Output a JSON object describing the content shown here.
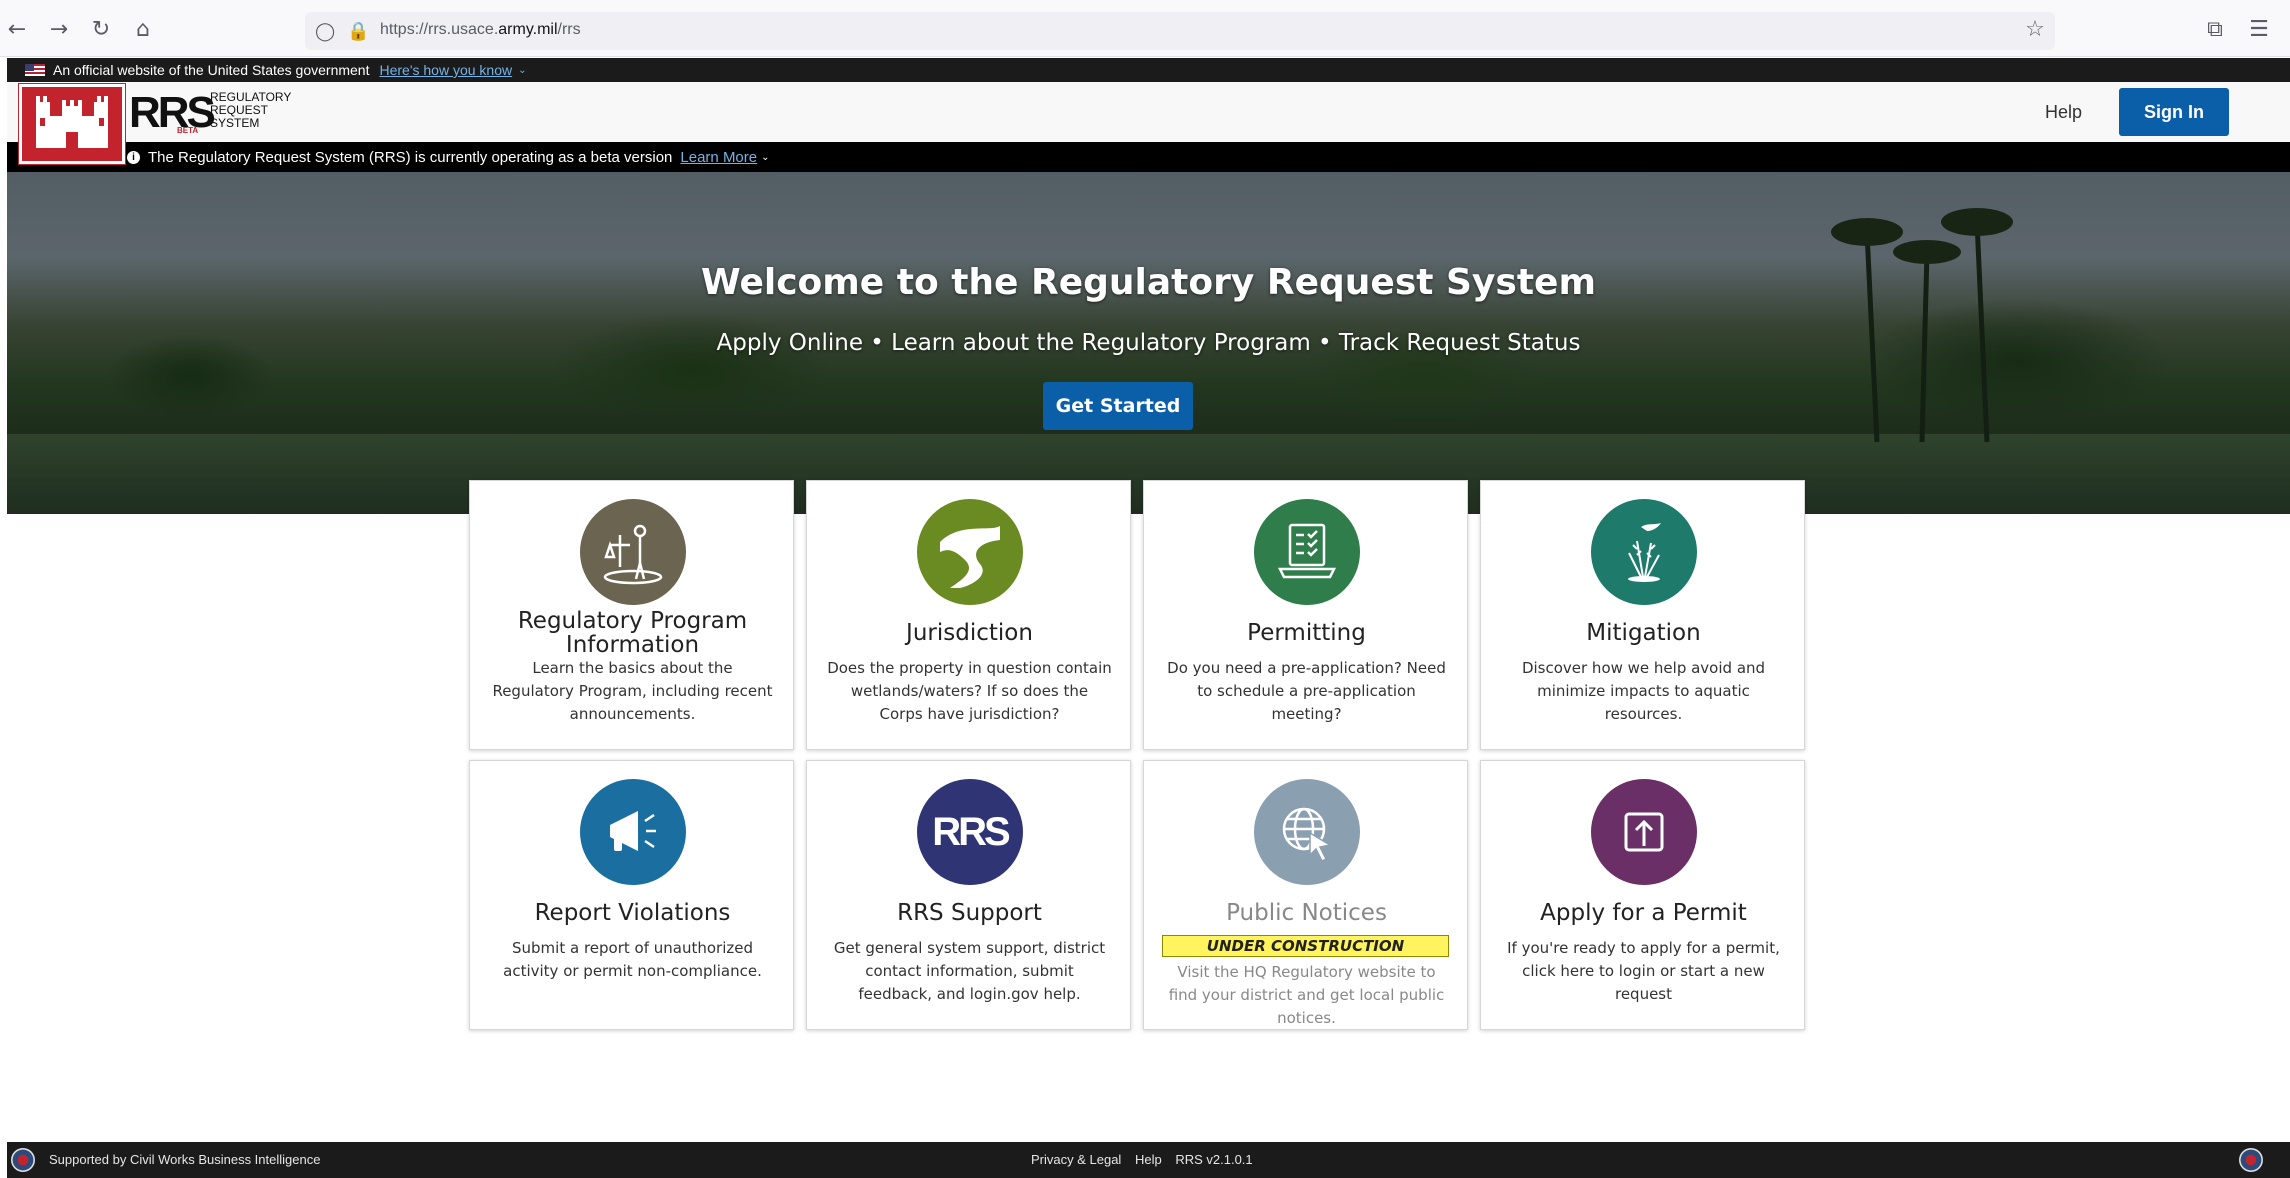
{
  "browser": {
    "url_prefix": "https://rrs.usace.",
    "url_domain": "army.mil",
    "url_suffix": "/rrs"
  },
  "gov_banner": {
    "text": "An official website of the United States government",
    "link": "Here's how you know"
  },
  "header": {
    "logo_text": "RRS",
    "logo_sub_1": "REGULATORY",
    "logo_sub_2": "REQUEST",
    "logo_sub_3": "SYSTEM",
    "logo_tag": "BETA",
    "help": "Help",
    "sign_in": "Sign In"
  },
  "beta_notice": {
    "text": "The Regulatory Request System (RRS) is currently operating as a beta version",
    "link": "Learn More"
  },
  "hero": {
    "title": "Welcome to the Regulatory Request System",
    "subtitle": "Apply Online • Learn about the Regulatory Program • Track Request Status",
    "button": "Get Started"
  },
  "cards": [
    {
      "title": "Regulatory Program Information",
      "desc": "Learn the basics about the Regulatory Program, including recent announcements.",
      "color": "#6b6450",
      "icon": "people-scale-icon"
    },
    {
      "title": "Jurisdiction",
      "desc": "Does the property in question contain wetlands/waters? If so does the Corps have jurisdiction?",
      "color": "#6a8a22",
      "icon": "river-icon"
    },
    {
      "title": "Permitting",
      "desc": "Do you need a pre-application? Need to schedule a pre-application meeting?",
      "color": "#2e7d4a",
      "icon": "laptop-checklist-icon"
    },
    {
      "title": "Mitigation",
      "desc": "Discover how we help avoid and minimize impacts to aquatic resources.",
      "color": "#1e7a6a",
      "icon": "bird-reeds-icon"
    },
    {
      "title": "Report Violations",
      "desc": "Submit a report of unauthorized activity or permit non-compliance.",
      "color": "#1a6fa0",
      "icon": "megaphone-icon"
    },
    {
      "title": "RRS Support",
      "desc": "Get general system support, district contact information, submit feedback, and login.gov help.",
      "color": "#2f3475",
      "icon": "rrs-logo-icon",
      "icon_text": "RRS"
    },
    {
      "title": "Public Notices",
      "desc": "Visit the HQ Regulatory website to find your district and get local public notices.",
      "color": "#8a9fb0",
      "icon": "globe-cursor-icon",
      "badge": "UNDER CONSTRUCTION"
    },
    {
      "title": "Apply for a Permit",
      "desc": "If you're ready to apply for a permit, click here to login or start a new request",
      "color": "#6a2f66",
      "icon": "upload-icon"
    }
  ],
  "footer": {
    "left": "Supported by Civil Works Business Intelligence",
    "privacy": "Privacy & Legal",
    "help": "Help",
    "version": "RRS v2.1.0.1"
  }
}
